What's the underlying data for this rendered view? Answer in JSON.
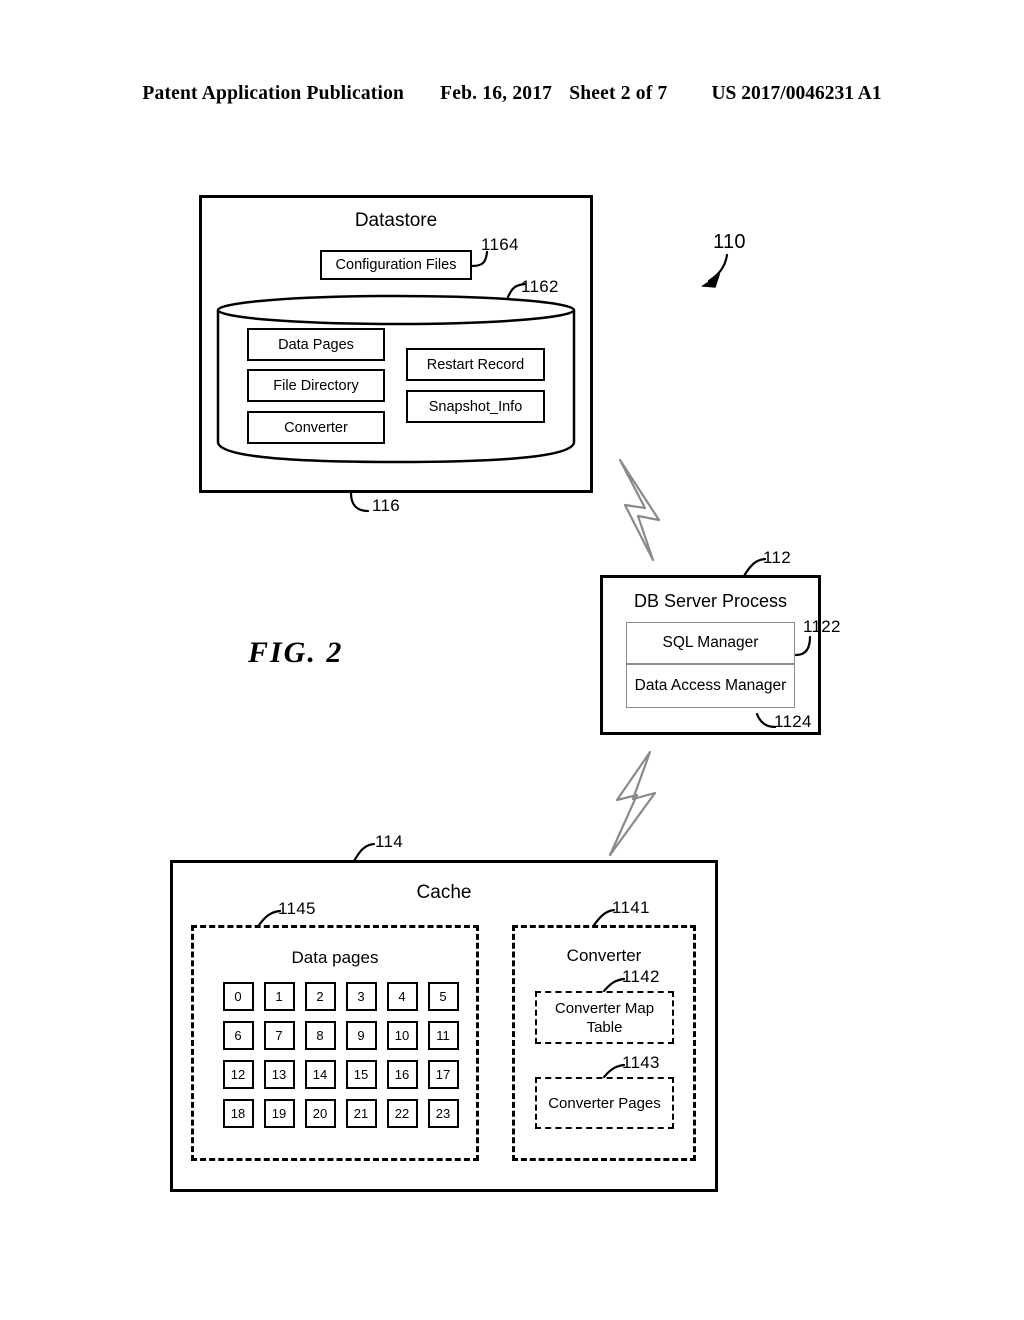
{
  "header": {
    "left": "Patent Application Publication",
    "date": "Feb. 16, 2017",
    "sheet": "Sheet 2 of 7",
    "pub_number": "US 2017/0046231 A1"
  },
  "figure": {
    "caption": "FIG. 2",
    "system_ref": "110"
  },
  "datastore": {
    "title": "Datastore",
    "ref": "116",
    "configuration_files": {
      "label": "Configuration Files",
      "ref": "1164"
    },
    "cylinder": {
      "ref": "1162"
    },
    "left_items": [
      {
        "label": "Data Pages"
      },
      {
        "label": "File Directory"
      },
      {
        "label": "Converter"
      }
    ],
    "right_items": [
      {
        "label": "Restart Record"
      },
      {
        "label": "Snapshot_Info"
      }
    ]
  },
  "db_server_process": {
    "title": "DB Server Process",
    "ref": "112",
    "components": [
      {
        "label": "SQL Manager",
        "ref": "1122"
      },
      {
        "label": "Data Access Manager",
        "ref": "1124"
      }
    ]
  },
  "cache": {
    "title": "Cache",
    "ref": "114",
    "data_pages": {
      "title": "Data pages",
      "ref": "1145",
      "cells": [
        "0",
        "1",
        "2",
        "3",
        "4",
        "5",
        "6",
        "7",
        "8",
        "9",
        "10",
        "11",
        "12",
        "13",
        "14",
        "15",
        "16",
        "17",
        "18",
        "19",
        "20",
        "21",
        "22",
        "23"
      ]
    },
    "converter": {
      "title": "Converter",
      "ref": "1141",
      "map_table": {
        "label": "Converter Map\nTable",
        "ref": "1142"
      },
      "pages": {
        "label": "Converter Pages",
        "ref": "1143"
      }
    }
  },
  "connectors": [
    {
      "name": "datastore-to-db-server-lightning"
    },
    {
      "name": "db-server-to-cache-lightning"
    }
  ]
}
